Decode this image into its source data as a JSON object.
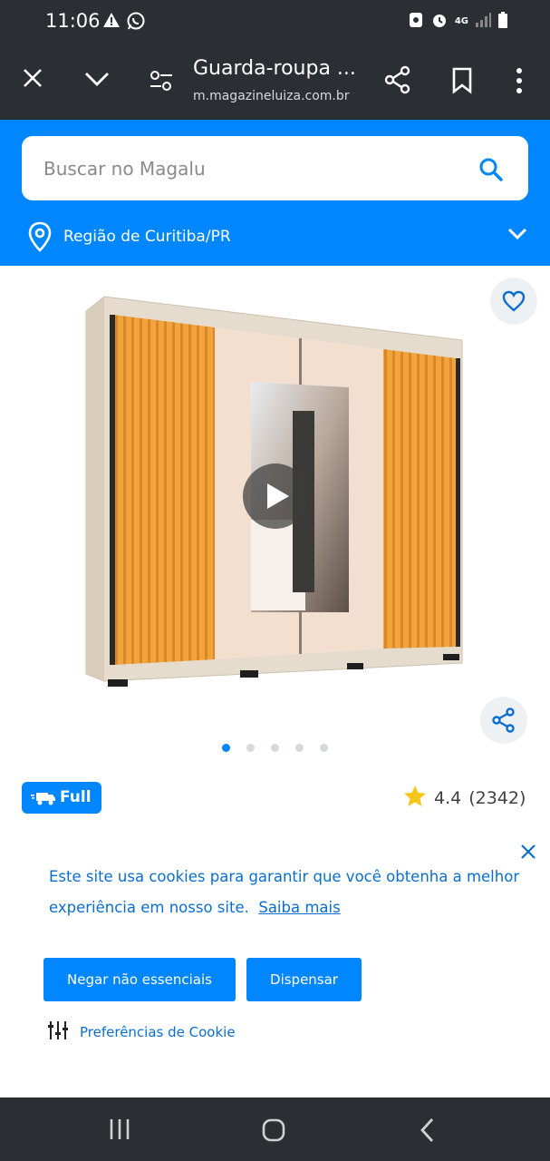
{
  "status_bar": {
    "time": "11:06",
    "left_icons": [
      "warning-icon",
      "whatsapp-icon"
    ],
    "right_icons": [
      "notification-icon",
      "alarm-icon",
      "network-4g-icon",
      "signal-icon",
      "battery-icon"
    ],
    "network_label": "4G"
  },
  "browser": {
    "page_title": "Guarda-roupa ...",
    "url": "m.magazineluiza.com.br"
  },
  "search": {
    "placeholder": "Buscar no Magalu"
  },
  "region": {
    "label": "Região de Curitiba/PR"
  },
  "carousel": {
    "total_images": 5,
    "active_index": 0
  },
  "product": {
    "badge_label": "Full",
    "rating": "4.4",
    "review_count": "(2342)"
  },
  "cookie_banner": {
    "message": "Este site usa cookies para garantir que você obtenha a melhor experiência em nosso site.",
    "learn_more": "Saiba mais",
    "deny_button": "Negar não essenciais",
    "dismiss_button": "Dispensar",
    "preferences": "Preferências de Cookie"
  },
  "colors": {
    "brand_blue": "#0086ff",
    "link_blue": "#0a6ed1",
    "system_bar": "#2b2f33",
    "star": "#f5c518"
  }
}
